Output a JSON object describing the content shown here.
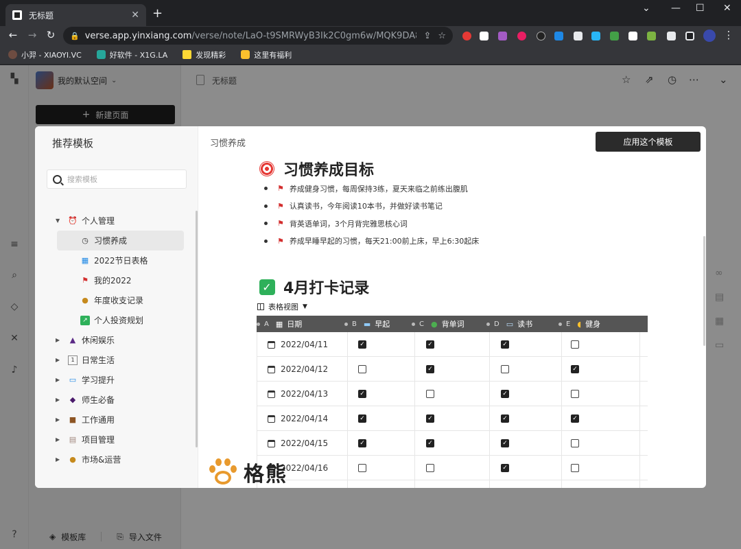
{
  "browser": {
    "tab_title": "无标题",
    "tab_close": "✕",
    "new_tab": "+",
    "win_min": "⌄",
    "win_min2": "—",
    "win_max": "☐",
    "win_close": "✕",
    "url_host": "verse.app.yinxiang.com",
    "url_path": "/verse/note/LaO-t9SMRWyB3Ik2C0gm6w/MQK9DA8CQa-q...",
    "bookmarks": [
      "小羿 - XIAOYI.VC",
      "好软件 - X1G.LA",
      "发现精彩",
      "这里有福利"
    ]
  },
  "app": {
    "workspace_name": "我的默认空间",
    "new_page_label": "新建页面",
    "doc_title": "无标题",
    "footer_templates": "模板库",
    "footer_import": "导入文件"
  },
  "modal": {
    "title": "推荐模板",
    "search_placeholder": "搜索模板",
    "breadcrumb": "习惯养成",
    "apply_label": "应用这个模板",
    "tree": [
      {
        "label": "个人管理",
        "icon": "alarm-clock-icon",
        "level": 0,
        "expanded": true
      },
      {
        "label": "习惯养成",
        "icon": "clock-icon",
        "level": 1,
        "selected": true
      },
      {
        "label": "2022节日表格",
        "icon": "calendar-icon",
        "level": 1
      },
      {
        "label": "我的2022",
        "icon": "red-flag-icon",
        "level": 1
      },
      {
        "label": "年度收支记录",
        "icon": "money-bag-icon",
        "level": 1
      },
      {
        "label": "个人投资规划",
        "icon": "chart-icon",
        "level": 1
      },
      {
        "label": "休闲娱乐",
        "icon": "top-hat-icon",
        "level": 0
      },
      {
        "label": "日常生活",
        "icon": "number-one-icon",
        "level": 0
      },
      {
        "label": "学习提升",
        "icon": "open-book-icon",
        "level": 0
      },
      {
        "label": "师生必备",
        "icon": "graduation-cap-icon",
        "level": 0
      },
      {
        "label": "工作通用",
        "icon": "briefcase-icon",
        "level": 0
      },
      {
        "label": "项目管理",
        "icon": "clipboard-icon",
        "level": 0
      },
      {
        "label": "市场&运营",
        "icon": "money-bag-icon",
        "level": 0
      }
    ],
    "heading1": "习惯养成目标",
    "goals": [
      "养成健身习惯，每周保持3练，夏天来临之前练出腹肌",
      "认真读书，今年阅读10本书，并做好读书笔记",
      "背英语单词，3个月背完雅思核心词",
      "养成早睡早起的习惯，每天21:00前上床，早上6:30起床"
    ],
    "heading2": "4月打卡记录",
    "view_label": "表格视图",
    "columns": [
      {
        "letter": "A",
        "label": "日期",
        "icon": "calendar-icon"
      },
      {
        "letter": "B",
        "label": "早起",
        "icon": "sunrise-icon"
      },
      {
        "letter": "C",
        "label": "背单词",
        "icon": "globe-icon"
      },
      {
        "letter": "D",
        "label": "读书",
        "icon": "book-icon"
      },
      {
        "letter": "E",
        "label": "健身",
        "icon": "flexed-biceps-icon"
      }
    ],
    "rows": [
      {
        "date": "2022/04/11",
        "checks": [
          true,
          true,
          true,
          false
        ]
      },
      {
        "date": "2022/04/12",
        "checks": [
          false,
          true,
          false,
          true
        ]
      },
      {
        "date": "2022/04/13",
        "checks": [
          true,
          false,
          true,
          false
        ]
      },
      {
        "date": "2022/04/14",
        "checks": [
          true,
          true,
          true,
          true
        ]
      },
      {
        "date": "2022/04/15",
        "checks": [
          true,
          true,
          true,
          false
        ]
      },
      {
        "date": "2022/04/16",
        "checks": [
          false,
          false,
          true,
          false
        ]
      }
    ]
  },
  "watermark": {
    "text": "格熊"
  },
  "colors": {
    "apply_button": "#2b2b2b",
    "flag": "#d32f2f",
    "check_emoji": "#2eb05a",
    "paw": "#e89a2e"
  }
}
